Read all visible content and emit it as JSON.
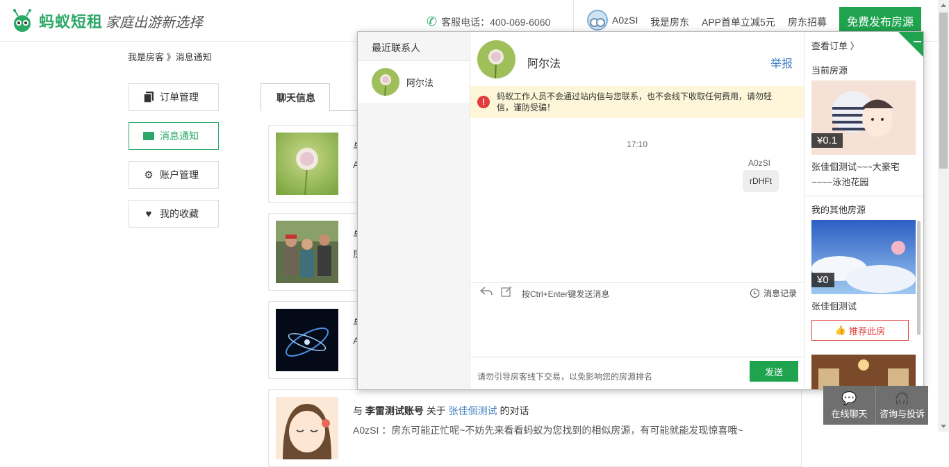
{
  "header": {
    "brand": "蚂蚁短租",
    "slogan": "家庭出游新选择",
    "hotline_label": "客服电话：",
    "hotline_number": "400-069-6060",
    "username": "A0zSI",
    "nav": [
      "我是房东",
      "APP首单立减5元",
      "房东招募"
    ],
    "publish_label": "免费发布房源"
  },
  "breadcrumb": "我是房客 》消息通知",
  "menu": [
    {
      "label": "订单管理",
      "icon": "document-icon",
      "active": false
    },
    {
      "label": "消息通知",
      "icon": "message-icon",
      "active": true
    },
    {
      "label": "账户管理",
      "icon": "gear-icon",
      "active": false
    },
    {
      "label": "我的收藏",
      "icon": "heart-icon",
      "active": false
    }
  ],
  "chat_tab": "聊天信息",
  "conversations": [
    {
      "title": "与",
      "line": "A"
    },
    {
      "title": "与",
      "line": "房"
    },
    {
      "title": "与",
      "line": "A"
    },
    {
      "title_prefix": "与 ",
      "contact": "李雷测试账号",
      "title_mid": " 关于 ",
      "listing": "张佳佪测试",
      "title_suffix": " 的对话",
      "line": "A0zSI ：房东可能正忙呢~不妨先来看看蚂蚁为您找到的相似房源，有可能就能发现惊喜哦~"
    }
  ],
  "chat": {
    "contacts_title": "最近联系人",
    "contact_name": "阿尔法",
    "header_name": "阿尔法",
    "report_label": "举报",
    "warning": "蚂蚁工作人员不会通过站内信与您联系，也不会线下收取任何费用，请勿轻信，谨防受骗！",
    "time": "17:10",
    "sender": "A0zSI",
    "message": "rDHFt",
    "input_hint": "按Ctrl+Enter键发送消息",
    "history_label": "消息记录",
    "footer_hint": "请勿引导房客线下交易，以免影响您的房源排名",
    "send_label": "发送"
  },
  "side": {
    "order_link": "查看订单 〉",
    "current_label": "当前房源",
    "current_price": "¥0.1",
    "current_title": "张佳佪测试~~~大豪宅~~~~泳池花园",
    "other_label": "我的其他房源",
    "other_price": "¥0",
    "other_title": "张佳佪测试",
    "recommend_label": "推荐此房"
  },
  "float": {
    "chat_label": "在线聊天",
    "complain_label": "咨询与投诉"
  },
  "colors": {
    "brand_green": "#2aa866",
    "button_green": "#1fa34e",
    "warning_red": "#e23c3c",
    "link_blue": "#3d7fc1"
  }
}
